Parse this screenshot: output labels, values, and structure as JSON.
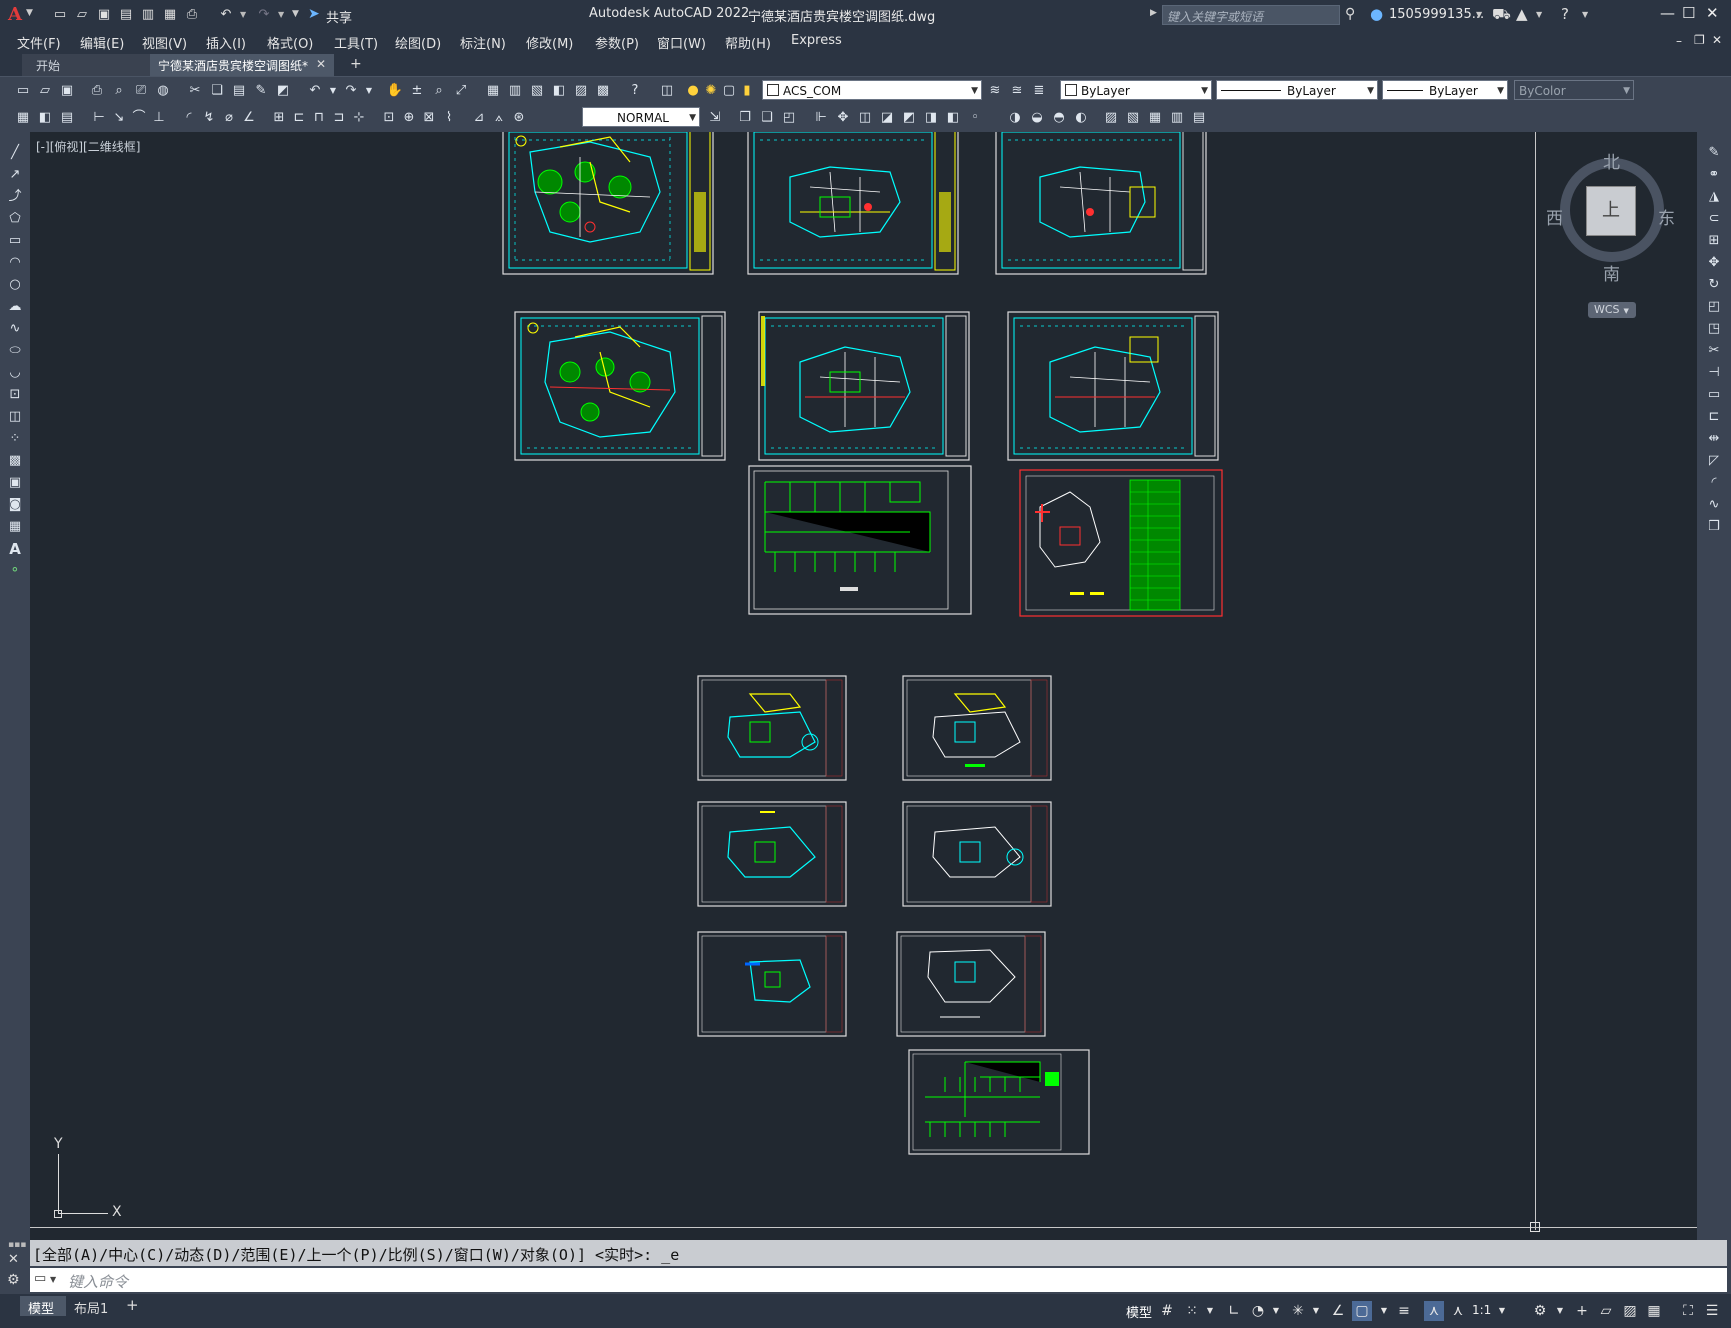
{
  "title_bar": {
    "app_title": "Autodesk AutoCAD 2022",
    "doc_title": "宁德某酒店贵宾楼空调图纸.dwg",
    "share_label": "共享",
    "search_placeholder": "键入关键字或短语",
    "user_name": "1505999135..."
  },
  "menu": {
    "items": [
      "文件(F)",
      "编辑(E)",
      "视图(V)",
      "插入(I)",
      "格式(O)",
      "工具(T)",
      "绘图(D)",
      "标注(N)",
      "修改(M)",
      "参数(P)",
      "窗口(W)",
      "帮助(H)",
      "Express"
    ]
  },
  "tabs": {
    "start": "开始",
    "active": "宁德某酒店贵宾楼空调图纸*",
    "close": "✕",
    "add": "+"
  },
  "toolbar1": {
    "layer": "ACS_COM",
    "color": "ByLayer",
    "linetype": "ByLayer",
    "lineweight": "ByLayer",
    "plotstyle": "ByColor"
  },
  "toolbar2": {
    "dimstyle": "NORMAL"
  },
  "viewport": {
    "label": "[-][俯视][二维线框]"
  },
  "viewcube": {
    "north": "北",
    "south": "南",
    "east": "东",
    "west": "西",
    "top": "上",
    "wcs": "WCS"
  },
  "ucs": {
    "x": "X",
    "y": "Y"
  },
  "command": {
    "history": "[全部(A)/中心(C)/动态(D)/范围(E)/上一个(P)/比例(S)/窗口(W)/对象(O)] <实时>: _e",
    "placeholder": "键入命令"
  },
  "layout_tabs": [
    "模型",
    "布局1"
  ],
  "status": {
    "mode": "模型",
    "scale": "1:1"
  },
  "colors": {
    "canvas": "#212830",
    "chrome": "#2b3442",
    "toolbar": "#3b4453",
    "cyan": "#00ffff",
    "green": "#00ff00",
    "yellow": "#ffff00",
    "red": "#ff3030"
  }
}
